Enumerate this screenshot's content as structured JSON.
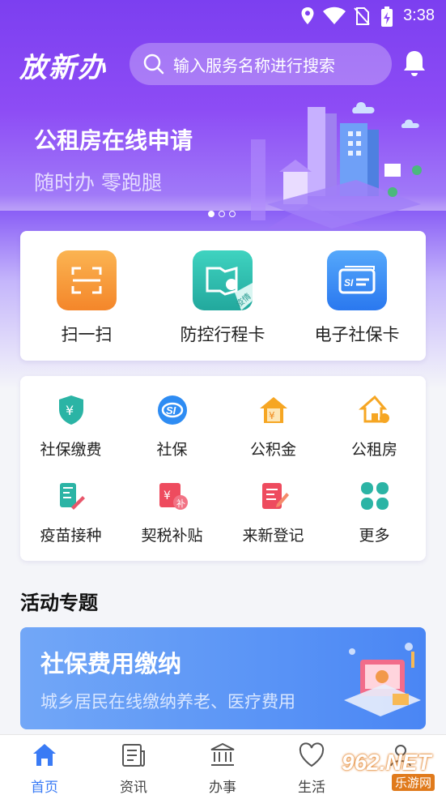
{
  "status_bar": {
    "time": "3:38"
  },
  "header": {
    "logo_text": "放新办",
    "search_placeholder": "输入服务名称进行搜索"
  },
  "banner": {
    "title": "公租房在线申请",
    "subtitle": "随时办 零跑腿",
    "page_count": 3,
    "active_page": 1
  },
  "main_services": [
    {
      "label": "扫一扫",
      "icon": "scan-icon",
      "color": "#f7993a"
    },
    {
      "label": "防控行程卡",
      "icon": "travel-card-icon",
      "color": "#2fc2b3",
      "badge": "疫情"
    },
    {
      "label": "电子社保卡",
      "icon": "social-security-card-icon",
      "color": "#3a8cf5"
    }
  ],
  "services": [
    {
      "label": "社保缴费",
      "icon": "shield-yen-icon"
    },
    {
      "label": "社保",
      "icon": "si-icon"
    },
    {
      "label": "公积金",
      "icon": "house-yen-icon"
    },
    {
      "label": "公租房",
      "icon": "house-icon"
    },
    {
      "label": "疫苗接种",
      "icon": "vaccine-icon"
    },
    {
      "label": "契税补贴",
      "icon": "tax-subsidy-icon"
    },
    {
      "label": "来新登记",
      "icon": "register-icon"
    },
    {
      "label": "更多",
      "icon": "more-icon"
    }
  ],
  "activity": {
    "section_title": "活动专题",
    "promo_title": "社保费用缴纳",
    "promo_subtitle": "城乡居民在线缴纳养老、医疗费用"
  },
  "tabbar": [
    {
      "label": "首页",
      "icon": "home-icon",
      "active": true
    },
    {
      "label": "资讯",
      "icon": "news-icon",
      "active": false
    },
    {
      "label": "办事",
      "icon": "government-icon",
      "active": false
    },
    {
      "label": "生活",
      "icon": "heart-icon",
      "active": false
    },
    {
      "label": "",
      "icon": "user-icon",
      "active": false
    }
  ],
  "watermark": {
    "text": "962.NET",
    "sub": "乐游网"
  },
  "colors": {
    "primary": "#7c3ff0",
    "tab_active": "#3a7bf5"
  }
}
